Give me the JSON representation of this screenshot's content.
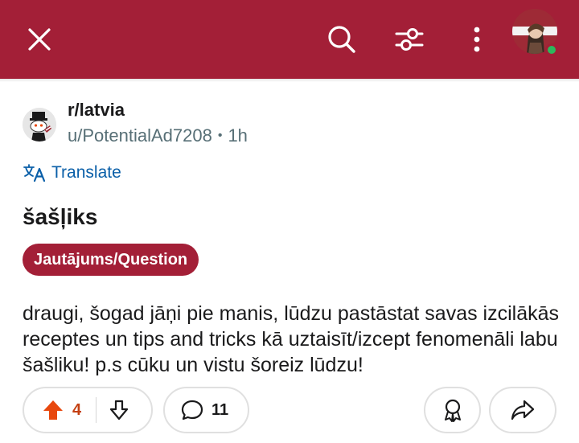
{
  "header": {
    "close_icon": "close-icon",
    "search_icon": "search-icon",
    "filter_icon": "filter-icon",
    "more_icon": "more-vertical-icon",
    "accent_color": "#a31f37",
    "online_color": "#2eb85c"
  },
  "post": {
    "subreddit": "r/latvia",
    "author": "u/PotentialAd7208",
    "separator": "•",
    "age": "1h",
    "translate_label": "Translate",
    "title": "šašļiks",
    "flair": "Jautājums/Question",
    "body": "draugi, šogad jāņi pie manis, lūdzu pastāstat savas izcilākās receptes un tips and tricks kā uztaisīt/izcept fenomenāli labu šašliku! p.s cūku un vistu šoreiz lūdzu!"
  },
  "actions": {
    "upvotes": "4",
    "comments": "11",
    "upvote_color": "#e8480e",
    "vote_count_color": "#c44012"
  }
}
